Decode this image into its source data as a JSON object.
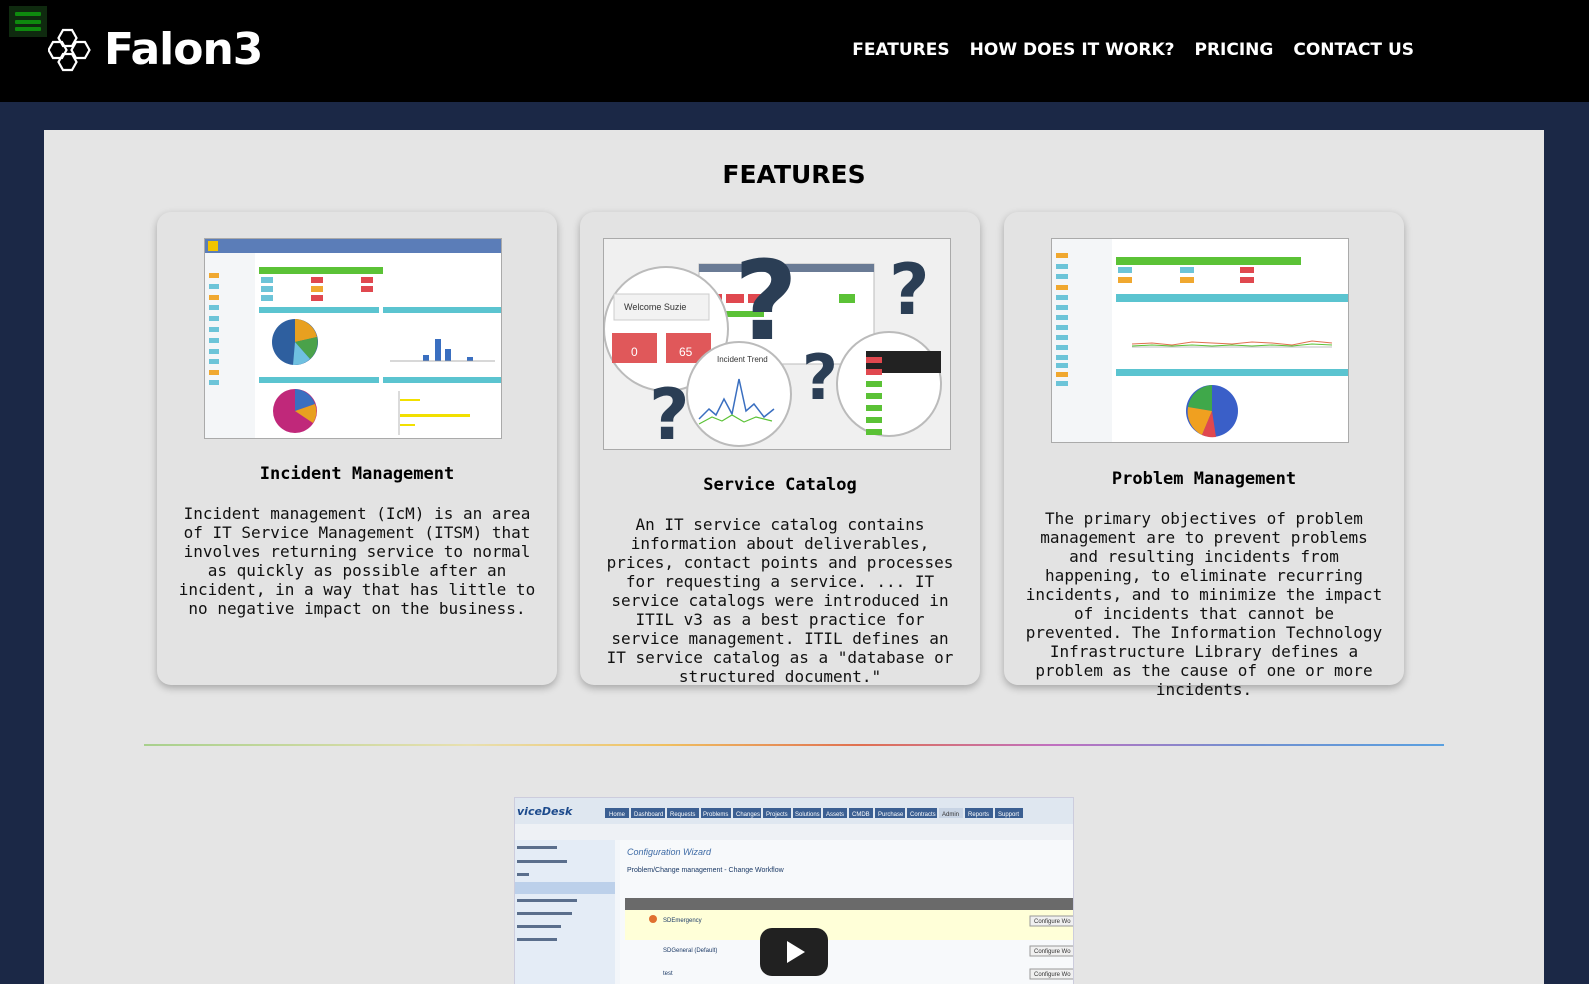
{
  "header": {
    "brand": "Falon3",
    "nav": [
      "FEATURES",
      "HOW DOES IT WORK?",
      "PRICING",
      "CONTACT US"
    ]
  },
  "features": {
    "title": "FEATURES",
    "cards": [
      {
        "title": "Incident Management",
        "text": "Incident management (IcM) is an area of IT Service Management (ITSM) that involves returning service to normal as quickly as possible after an incident, in a way that has little to no negative impact on the business."
      },
      {
        "title": "Service Catalog",
        "text": "An IT service catalog contains information about deliverables, prices, contact points and processes for requesting a service. ... IT service catalogs were introduced in ITIL v3 as a best practice for service management. ITIL defines an IT service catalog as a \"database or structured document.\"",
        "image_labels": {
          "welcome": "Welcome Suzie",
          "trend": "Incident Trend",
          "value_a": "0",
          "value_b": "65"
        }
      },
      {
        "title": "Problem Management",
        "text": "The primary objectives of problem management are to prevent problems and resulting incidents from happening, to eliminate recurring incidents, and to minimize the impact of incidents that cannot be prevented. The Information Technology Infrastructure Library defines a problem as the cause of one or more incidents."
      }
    ]
  },
  "video": {
    "heading": "Configuration Wizard",
    "subheading": "Problem/Change management - Change Workflow",
    "tabs": [
      "Home",
      "Dashboard",
      "Requests",
      "Problems",
      "Changes",
      "Projects",
      "Solutions",
      "Assets",
      "CMDB",
      "Purchase",
      "Contracts",
      "Admin",
      "Reports",
      "Support"
    ],
    "rows": [
      "SDEmergency",
      "SDGeneral (Default)",
      "test"
    ],
    "action_label": "Configure Wo"
  },
  "colors": {
    "header_bg": "#000000",
    "page_bg": "#1b2846",
    "panel_bg": "#e5e5e5",
    "menu_green": "#0e8a0e"
  },
  "icons": [
    "hamburger-menu-icon",
    "hexagon-logo-icon",
    "play-icon"
  ]
}
